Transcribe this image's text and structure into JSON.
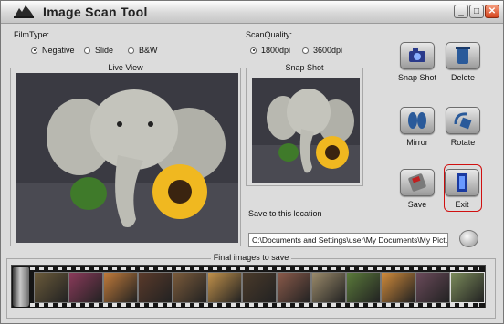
{
  "window": {
    "title": "Image Scan Tool"
  },
  "film_type": {
    "label": "FilmType:",
    "options": [
      {
        "label": "Negative",
        "selected": true
      },
      {
        "label": "Slide",
        "selected": false
      },
      {
        "label": "B&W",
        "selected": false
      }
    ]
  },
  "scan_quality": {
    "label": "ScanQuality:",
    "options": [
      {
        "label": "1800dpi",
        "selected": true
      },
      {
        "label": "3600dpi",
        "selected": false
      }
    ]
  },
  "live_view": {
    "title": "Live View"
  },
  "snap_shot": {
    "title": "Snap Shot"
  },
  "tools": {
    "snapshot": "Snap Shot",
    "delete": "Delete",
    "mirror": "Mirror",
    "rotate": "Rotate",
    "save": "Save",
    "exit": "Exit"
  },
  "save_location": {
    "label": "Save to this location",
    "path": "C:\\Documents and Settings\\user\\My Documents\\My Pictures"
  },
  "final_images": {
    "title": "Final images to save",
    "thumb_colors": [
      "#6a5a3a",
      "#8a3a5a",
      "#c07a3a",
      "#5a3a2a",
      "#7a5a3a",
      "#c0904a",
      "#4a3a2a",
      "#8a5a4a",
      "#9a8a6a",
      "#5a7a3a",
      "#d08a3a",
      "#6a4a5a",
      "#7a8a5a"
    ]
  },
  "colors": {
    "accent_exit": "#d01010",
    "background": "#dcdcdc"
  }
}
